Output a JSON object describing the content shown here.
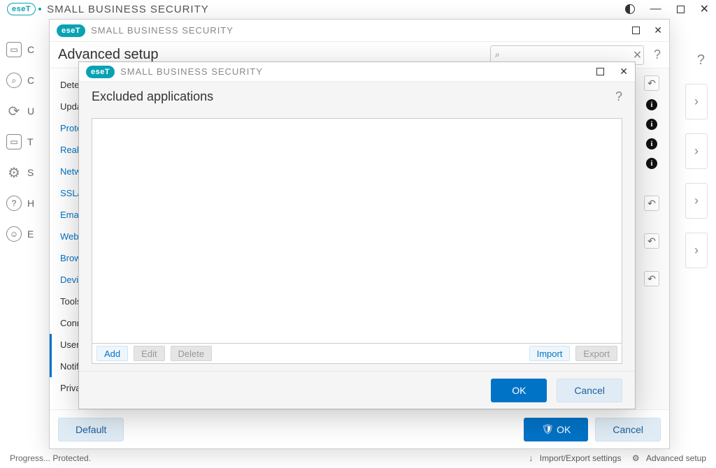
{
  "brand": {
    "logo_text": "eseT",
    "product_name": "SMALL BUSINESS SECURITY"
  },
  "main_window": {
    "title": "SMALL BUSINESS SECURITY",
    "sidebar_letters": [
      "C",
      "C",
      "U",
      "T",
      "S",
      "H",
      "E"
    ],
    "help_icon": "?",
    "right_chevron": "›"
  },
  "statusbar": {
    "left": "Progress... Protected.",
    "link1": "Import/Export settings",
    "link2": "Advanced setup",
    "gear": "⚙"
  },
  "advanced_setup": {
    "window_title": "SMALL BUSINESS SECURITY",
    "heading": "Advanced setup",
    "search_placeholder": "",
    "help_icon": "?",
    "nav": {
      "detection": "Detection",
      "update": "Update",
      "protections": "Protections",
      "real_time": "Real-time protection",
      "network": "Network",
      "ssl": "SSL/TLS",
      "email": "Email",
      "web": "Web",
      "browser": "Browser",
      "device": "Device",
      "tools": "Tools",
      "connectivity": "Connectivity",
      "user_interface": "User interface",
      "notifications": "Notifications",
      "privacy": "Privacy"
    },
    "footer": {
      "default": "Default",
      "ok": "OK",
      "cancel": "Cancel",
      "shield": "🛡"
    }
  },
  "dialog": {
    "window_title": "SMALL BUSINESS SECURITY",
    "heading": "Excluded applications",
    "help_icon": "?",
    "toolbar": {
      "add": "Add",
      "edit": "Edit",
      "delete": "Delete",
      "import": "Import",
      "export": "Export"
    },
    "footer": {
      "ok": "OK",
      "cancel": "Cancel"
    }
  }
}
